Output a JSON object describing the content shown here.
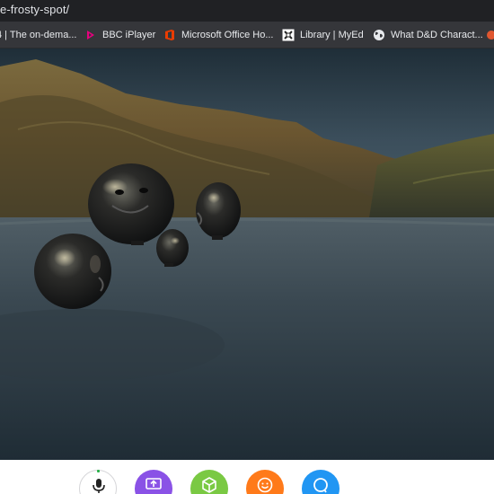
{
  "browser": {
    "url": "e-frosty-spot/"
  },
  "bookmarks": [
    {
      "label": "4 | The on-dema...",
      "icon": "page-icon"
    },
    {
      "label": "BBC iPlayer",
      "icon": "bbc-iplayer-icon"
    },
    {
      "label": "Microsoft Office Ho...",
      "icon": "office-icon"
    },
    {
      "label": "Library | MyEd",
      "icon": "myed-icon"
    },
    {
      "label": "What D&D Charact...",
      "icon": "globe-icon"
    }
  ],
  "scene": {
    "description_colors": {
      "sky": "#3c4f5c",
      "hills": "#6e5a35",
      "water": "#34424c"
    }
  },
  "toolbar": {
    "buttons": [
      {
        "name": "microphone",
        "icon": "microphone-icon",
        "color": "#ffffff"
      },
      {
        "name": "share-screen",
        "icon": "screen-share-icon",
        "color": "#8a52e6"
      },
      {
        "name": "place-object",
        "icon": "cube-icon",
        "color": "#7ac943"
      },
      {
        "name": "react",
        "icon": "smiley-icon",
        "color": "#ff7a1a"
      },
      {
        "name": "chat",
        "icon": "chat-bubble-icon",
        "color": "#2196f3"
      }
    ]
  }
}
